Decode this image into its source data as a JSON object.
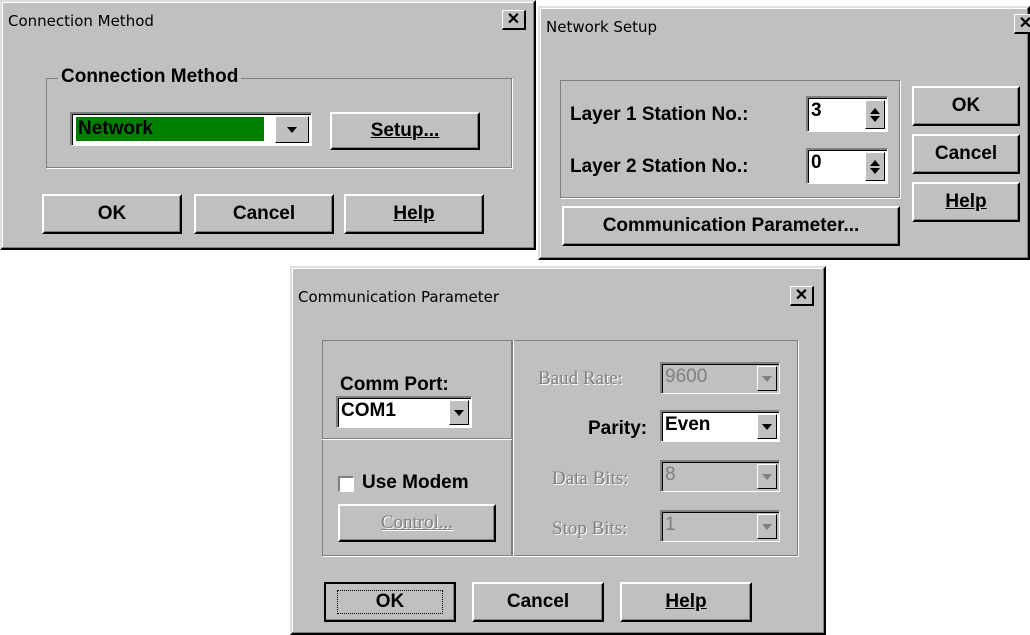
{
  "connection_method_dialog": {
    "title": "Connection Method",
    "group_label": "Connection Method",
    "method_value": "Network",
    "method_highlight_color": "#008000",
    "setup_button": "Setup...",
    "ok_button": "OK",
    "cancel_button": "Cancel",
    "help_button": "Help",
    "close_glyph": "✕"
  },
  "network_setup_dialog": {
    "title": "Network Setup",
    "layer1_label": "Layer 1 Station No.:",
    "layer1_value": "3",
    "layer2_label": "Layer 2 Station No.:",
    "layer2_value": "0",
    "ok_button": "OK",
    "cancel_button": "Cancel",
    "help_button": "Help",
    "comm_param_button": "Communication Parameter...",
    "close_glyph": "✕"
  },
  "comm_param_dialog": {
    "title": "Communication Parameter",
    "comm_port_label": "Comm Port:",
    "comm_port_value": "COM1",
    "use_modem_label": "Use Modem",
    "use_modem_checked": false,
    "control_button": "Control...",
    "baud_rate_label": "Baud Rate:",
    "baud_rate_value": "9600",
    "parity_label": "Parity:",
    "parity_value": "Even",
    "data_bits_label": "Data Bits:",
    "data_bits_value": "8",
    "stop_bits_label": "Stop Bits:",
    "stop_bits_value": "1",
    "ok_button": "OK",
    "cancel_button": "Cancel",
    "help_button": "Help",
    "close_glyph": "✕"
  }
}
